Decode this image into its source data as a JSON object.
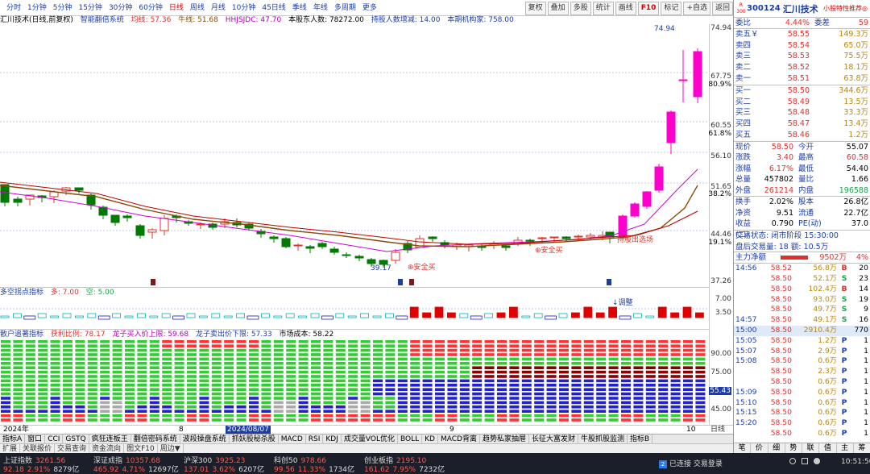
{
  "period_tabs": [
    "分时",
    "1分钟",
    "5分钟",
    "15分钟",
    "30分钟",
    "60分钟",
    "日线",
    "周线",
    "月线",
    "10分钟",
    "45日线",
    "季线",
    "年线",
    "多周期",
    "更多"
  ],
  "active_period": "日线",
  "tool_buttons": [
    "复权",
    "叠加",
    "多股",
    "统计",
    "画线",
    "F10",
    "标记",
    "+自选",
    "返回"
  ],
  "main_indicator": {
    "title": "汇川技术(日线,前复权)",
    "fx": "智能翻倍系统",
    "ma_label": "均线: 57.36",
    "ox_label": "牛线: 51.68",
    "hj_label": "HHJSJDC: 47.70",
    "holders": "本股东人数: 78272.00",
    "inc": "持股人数增减: 14.00",
    "inst": "本期机构家: 758.00"
  },
  "price_axis": [
    "74.94",
    "67.75",
    "80.9%",
    "60.55",
    "61.8%",
    "56.10",
    "51.65",
    "38.2%",
    "44.46",
    "19.1%",
    "37.26"
  ],
  "annotations": {
    "high": "74.94",
    "low": "39.17",
    "safe_buy": "安全买",
    "safe_buy2": "安全买",
    "sell_zone": "持股出选场",
    "adjust": "调整"
  },
  "ind2": {
    "title": "多空拐点指标",
    "many_label": "多: 7.00",
    "empty_label": "空: 5.00",
    "axis": [
      "7.00",
      "3.50"
    ]
  },
  "ind3": {
    "title": "散户追著指标",
    "ratio": "获利比例: 78.17",
    "buy": "龙子买入价上限: 59.68",
    "sell": "龙子卖出价下限: 57.33",
    "cost": "市场成本: 58.22",
    "axis": [
      "90.00",
      "75.00",
      "55.43",
      "45.00"
    ]
  },
  "date_labels": [
    "2024年",
    "8",
    "2024/08/07",
    "9",
    "10",
    "日线"
  ],
  "bottom_tabs": [
    "指标A",
    "窗口",
    "CCI",
    "GSTQ",
    "疯狂连板王",
    "翻倍密码系统",
    "波段操盘系统",
    "抓妖股秘杀股",
    "MACD",
    "RSI",
    "KDJ",
    "成交量VOL优化",
    "BOLL",
    "KD",
    "MACD背离",
    "趋势私家抽屉",
    "长征大富发财",
    "牛股抓股监测",
    "指标B"
  ],
  "bottom_tabs2": [
    "扩展",
    "关联报价",
    "交易查询",
    "资金流向",
    "图文F10",
    "周边▼"
  ],
  "taskbar": {
    "row1": [
      {
        "n": "上证指数",
        "v": "3261.56"
      },
      {
        "n": "深证成指",
        "v": "10357.68"
      },
      {
        "n": "沪深300",
        "v": "3925.23"
      },
      {
        "n": "科创50",
        "v": "978.66"
      },
      {
        "n": "创业板指",
        "v": "2195.10"
      }
    ],
    "row2": [
      {
        "c": "92.18",
        "p": "2.91%",
        "a": "8279亿"
      },
      {
        "c": "465.92",
        "p": "4.71%",
        "a": "12697亿"
      },
      {
        "c": "137.01",
        "p": "3.62%",
        "a": "6207亿"
      },
      {
        "c": "99.56",
        "p": "11.33%",
        "a": "1734亿"
      },
      {
        "c": "161.62",
        "p": "7.95%",
        "a": "7232亿"
      }
    ],
    "connected": "已连接 交易登录",
    "clock": "10:51:50"
  },
  "stock": {
    "code": "300124",
    "name": "汇川技术",
    "link": "小股特性推荐◎"
  },
  "weibi": {
    "k1": "委比",
    "v1": "4.44%",
    "k2": "委差",
    "v2": "59"
  },
  "asks": [
    {
      "l": "卖五￥",
      "p": "58.55",
      "v": "149.3万"
    },
    {
      "l": "卖四",
      "p": "58.54",
      "v": "65.0万"
    },
    {
      "l": "卖三",
      "p": "58.53",
      "v": "75.5万"
    },
    {
      "l": "卖二",
      "p": "58.52",
      "v": "18.1万"
    },
    {
      "l": "卖一",
      "p": "58.51",
      "v": "63.8万"
    }
  ],
  "bids": [
    {
      "l": "买一",
      "p": "58.50",
      "v": "344.6万"
    },
    {
      "l": "买二",
      "p": "58.49",
      "v": "13.5万"
    },
    {
      "l": "买三",
      "p": "58.48",
      "v": "33.3万"
    },
    {
      "l": "买四",
      "p": "58.47",
      "v": "13.4万"
    },
    {
      "l": "买五",
      "p": "58.46",
      "v": "1.2万"
    }
  ],
  "quote": [
    {
      "k": "现价",
      "v": "58.50",
      "k2": "今开",
      "v2": "55.07"
    },
    {
      "k": "涨跌",
      "v": "3.40",
      "k2": "最高",
      "v2": "60.58"
    },
    {
      "k": "涨幅",
      "v": "6.17%",
      "k2": "最低",
      "v2": "54.40"
    },
    {
      "k": "总量",
      "v": "457802",
      "k2": "量比",
      "v2": "1.66"
    },
    {
      "k": "外盘",
      "v": "261214",
      "k2": "内盘",
      "v2": "196588"
    }
  ],
  "quote2": [
    {
      "k": "换手",
      "v": "2.02%",
      "k2": "股本",
      "v2": "26.8亿"
    },
    {
      "k": "净资",
      "v": "9.51",
      "k2": "流通",
      "v2": "22.7亿"
    },
    {
      "k": "收益(二)",
      "v": "0.790",
      "k2": "PE(动)",
      "v2": "37.0"
    }
  ],
  "trade_status": "交易状态: 闭市阶段 15:30:00",
  "after_trade": "盘后交易量: 18  额: 10.5万",
  "main_flow": {
    "label": "主力净额",
    "v": "9502万",
    "p": "4%"
  },
  "ticks": [
    {
      "t": "14:56",
      "p": "58.52",
      "v": "56.8万",
      "bs": "B",
      "n": "20"
    },
    {
      "t": "",
      "p": "58.50",
      "v": "52.1万",
      "bs": "S",
      "n": "23"
    },
    {
      "t": "",
      "p": "58.50",
      "v": "102.4万",
      "bs": "B",
      "n": "14"
    },
    {
      "t": "",
      "p": "58.50",
      "v": "93.0万",
      "bs": "S",
      "n": "19"
    },
    {
      "t": "",
      "p": "58.50",
      "v": "49.7万",
      "bs": "S",
      "n": "9"
    },
    {
      "t": "14:57",
      "p": "58.50",
      "v": "49.1万",
      "bs": "S",
      "n": "16"
    },
    {
      "t": "15:00",
      "p": "58.50",
      "v": "2910.4万",
      "bs": "",
      "n": "770"
    },
    {
      "t": "15:05",
      "p": "58.50",
      "v": "1.2万",
      "bs": "P",
      "n": "1"
    },
    {
      "t": "15:07",
      "p": "58.50",
      "v": "2.9万",
      "bs": "P",
      "n": "1"
    },
    {
      "t": "15:08",
      "p": "58.50",
      "v": "0.6万",
      "bs": "P",
      "n": "1"
    },
    {
      "t": "",
      "p": "58.50",
      "v": "2.3万",
      "bs": "P",
      "n": "1"
    },
    {
      "t": "",
      "p": "58.50",
      "v": "0.6万",
      "bs": "P",
      "n": "1"
    },
    {
      "t": "15:09",
      "p": "58.50",
      "v": "0.6万",
      "bs": "P",
      "n": "1"
    },
    {
      "t": "15:10",
      "p": "58.50",
      "v": "0.6万",
      "bs": "P",
      "n": "1"
    },
    {
      "t": "15:15",
      "p": "58.50",
      "v": "0.6万",
      "bs": "P",
      "n": "1"
    },
    {
      "t": "15:20",
      "p": "58.50",
      "v": "0.6万",
      "bs": "P",
      "n": "1"
    },
    {
      "t": "",
      "p": "58.50",
      "v": "0.6万",
      "bs": "P",
      "n": "1"
    }
  ],
  "right_tabs": [
    "笔",
    "价",
    "细",
    "势",
    "联",
    "值",
    "主",
    "筹"
  ],
  "colors": {
    "up": "#e0302a",
    "down": "#1aa34a",
    "candle_up": "#ff00cc",
    "accent": "#1c3da8"
  }
}
